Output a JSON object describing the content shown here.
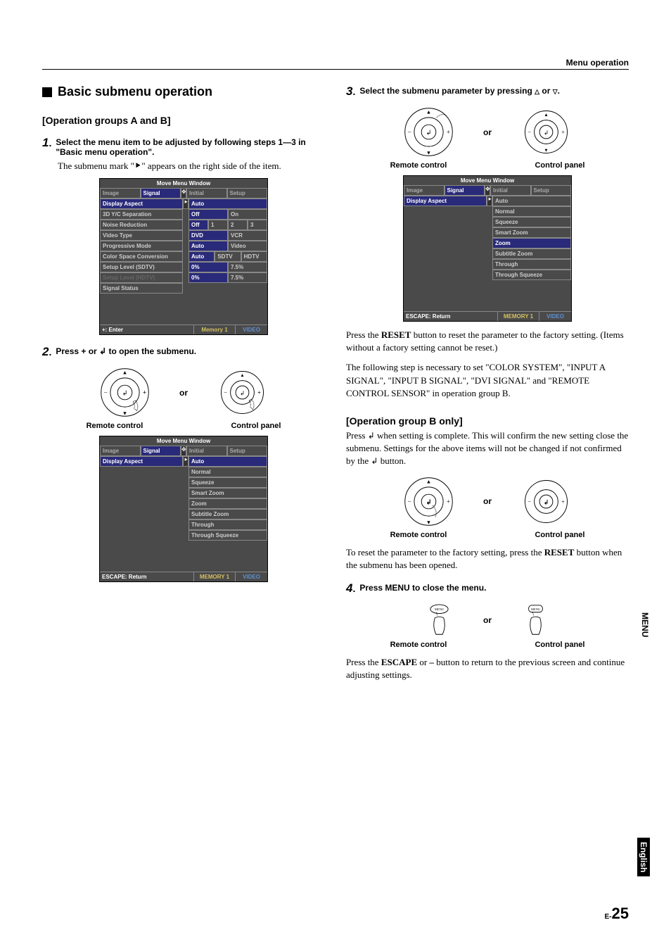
{
  "header": {
    "title": "Menu operation"
  },
  "sideTabs": {
    "menu": "MENU",
    "english": "English"
  },
  "pageNum": {
    "prefix": "E-",
    "num": "25"
  },
  "leftCol": {
    "heading": "Basic submenu operation",
    "groupTitle": "[Operation groups A and B]",
    "step1": {
      "num": "1",
      "text": "Select the menu item to be adjusted by following steps 1—3 in \"Basic menu operation\".",
      "body": "The submenu mark \"⯈\" appears on the right side of the item."
    },
    "step2": {
      "num": "2",
      "textPre": "Press + or ",
      "textPost": " to open the submenu."
    },
    "or": "or",
    "remote": "Remote control",
    "panel": "Control panel"
  },
  "rightCol": {
    "step3": {
      "num": "3",
      "text": "Select the submenu parameter by pressing △ or ▽."
    },
    "body1a": "Press the ",
    "body1b": "RESET",
    "body1c": " button to reset the parameter to the factory setting. (Items without a factory setting cannot be reset.)",
    "body2": "The following step is necessary to set \"COLOR SYSTEM\", \"INPUT A SIGNAL\", \"INPUT B SIGNAL\", \"DVI SIGNAL\" and \"REMOTE CONTROL SENSOR\" in operation group B.",
    "groupBTitle": "[Operation group B only]",
    "body3a": "Press ",
    "body3b": " when setting is complete. This will confirm the new setting close the submenu. Settings for the above items will not be changed if not confirmed by the ",
    "body3c": " button.",
    "body4a": "To reset the parameter to the factory setting, press the ",
    "body4b": "RESET",
    "body4c": " button when the submenu has been opened.",
    "step4": {
      "num": "4",
      "text": "Press MENU to close the menu."
    },
    "body5a": "Press the ",
    "body5b": "ESCAPE",
    "body5c": " or ",
    "body5d": "–",
    "body5e": " button to return to the previous screen and continue adjusting settings."
  },
  "menuWindow1": {
    "title": "Move Menu Window",
    "tabs": [
      "Image",
      "Signal",
      "Initial",
      "Setup"
    ],
    "rows": [
      {
        "label": "Display Aspect",
        "cursor": "⯈",
        "cells": [
          "Auto"
        ],
        "sel": true
      },
      {
        "label": "3D Y/C Separation",
        "cells": [
          "Off",
          "On"
        ]
      },
      {
        "label": "Noise Reduction",
        "cells": [
          "Off",
          "1",
          "2",
          "3"
        ]
      },
      {
        "label": "Video Type",
        "cells": [
          "DVD",
          "VCR"
        ]
      },
      {
        "label": "Progressive Mode",
        "cells": [
          "Auto",
          "Video"
        ]
      },
      {
        "label": "Color Space Conversion",
        "cells": [
          "Auto",
          "SDTV",
          "HDTV"
        ]
      },
      {
        "label": "Setup Level (SDTV)",
        "cells": [
          "0%",
          "7.5%"
        ]
      },
      {
        "label": "Setup Level (HDTV)",
        "gray": true,
        "cells": [
          "0%",
          "7.5%"
        ]
      },
      {
        "label": "Signal Status",
        "cells": []
      }
    ],
    "footer": {
      "left": "+: Enter",
      "mid": "Memory 1",
      "right": "VIDEO"
    }
  },
  "menuWindow2": {
    "title": "Move Menu Window",
    "tabs": [
      "Image",
      "Signal",
      "Initial",
      "Setup"
    ],
    "row": {
      "label": "Display Aspect",
      "cursor": "⯈"
    },
    "options": [
      "Auto",
      "Normal",
      "Squeeze",
      "Smart Zoom",
      "Zoom",
      "Subtitle Zoom",
      "Through",
      "Through Squeeze"
    ],
    "footer": {
      "left": "ESCAPE: Return",
      "mid": "MEMORY 1",
      "right": "VIDEO"
    }
  },
  "menuWindow3": {
    "title": "Move Menu Window",
    "tabs": [
      "Image",
      "Signal",
      "Initial",
      "Setup"
    ],
    "row": {
      "label": "Display Aspect",
      "cursor": "⯈"
    },
    "options": [
      "Auto",
      "Normal",
      "Squeeze",
      "Smart Zoom",
      "Zoom",
      "Subtitle Zoom",
      "Through",
      "Through Squeeze"
    ],
    "selIdx": 4,
    "footer": {
      "left": "ESCAPE: Return",
      "mid": "MEMORY 1",
      "right": "VIDEO"
    }
  }
}
